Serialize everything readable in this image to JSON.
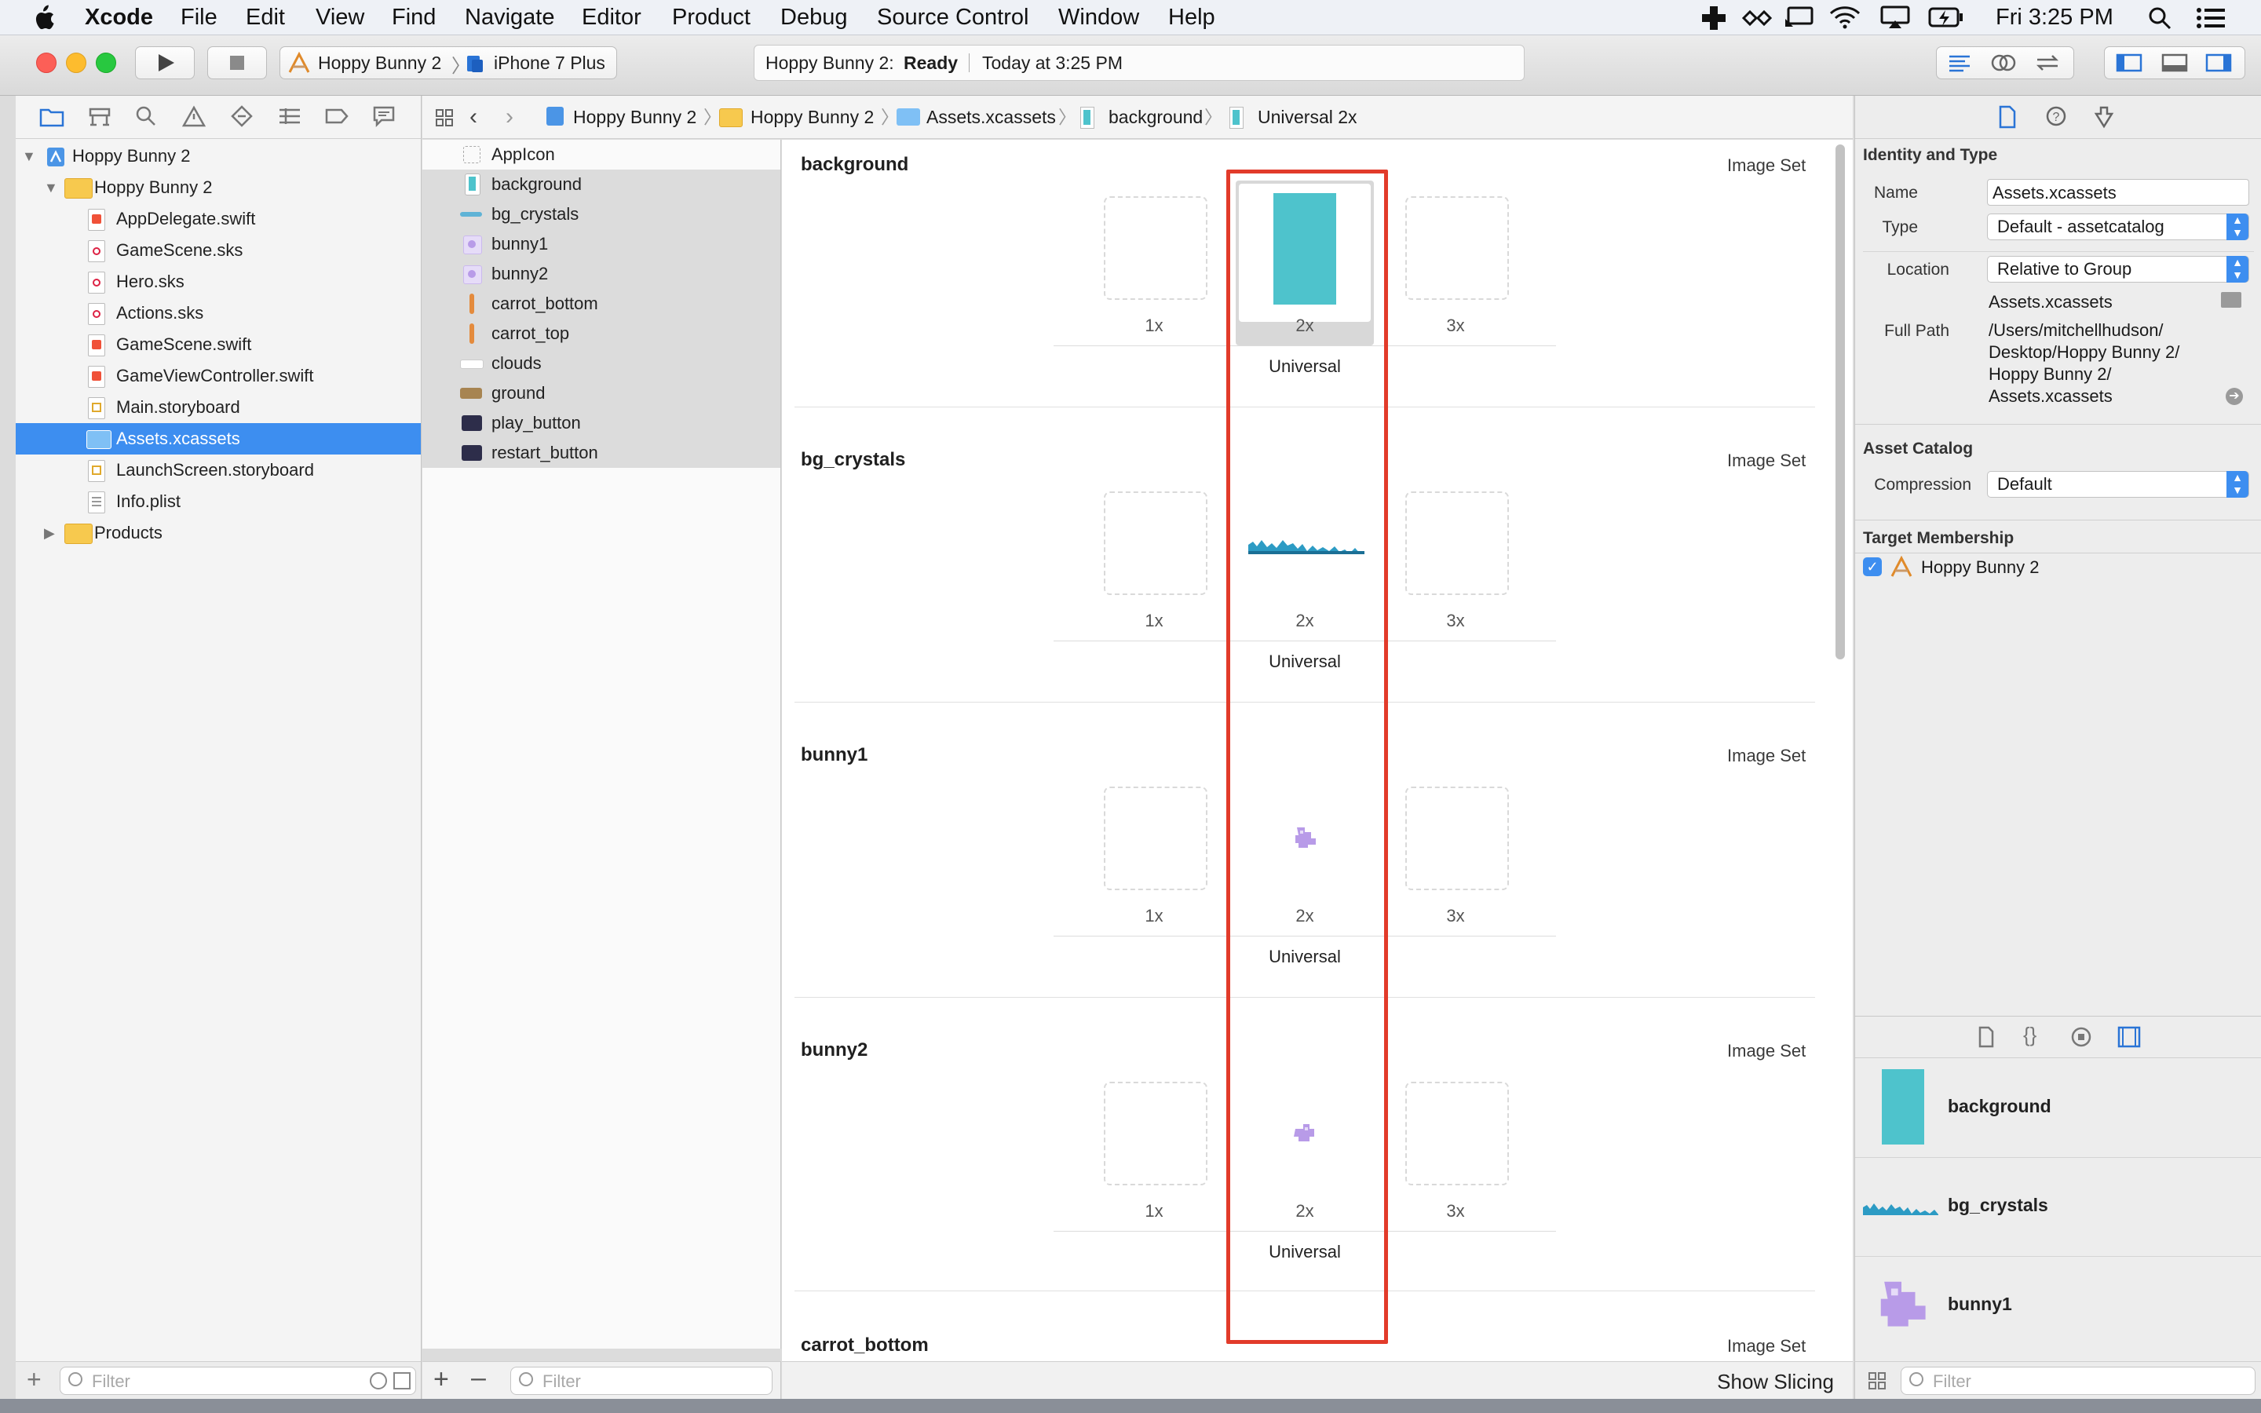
{
  "menubar": {
    "app_name": "Xcode",
    "menus": [
      "File",
      "Edit",
      "View",
      "Find",
      "Navigate",
      "Editor",
      "Product",
      "Debug",
      "Source Control",
      "Window",
      "Help"
    ],
    "clock": "Fri 3:25 PM"
  },
  "toolbar": {
    "scheme": "Hoppy Bunny 2",
    "device": "iPhone 7 Plus",
    "status_project": "Hoppy Bunny 2:",
    "status_state": "Ready",
    "status_time": "Today at 3:25 PM"
  },
  "navigator": {
    "project": "Hoppy Bunny 2",
    "group": "Hoppy Bunny 2",
    "files": [
      "AppDelegate.swift",
      "GameScene.sks",
      "Hero.sks",
      "Actions.sks",
      "GameScene.swift",
      "GameViewController.swift",
      "Main.storyboard",
      "Assets.xcassets",
      "LaunchScreen.storyboard",
      "Info.plist"
    ],
    "products": "Products",
    "filter_placeholder": "Filter"
  },
  "jumpbar": [
    "Hoppy Bunny 2",
    "Hoppy Bunny 2",
    "Assets.xcassets",
    "background",
    "Universal 2x"
  ],
  "assets": {
    "items": [
      "AppIcon",
      "background",
      "bg_crystals",
      "bunny1",
      "bunny2",
      "carrot_bottom",
      "carrot_top",
      "clouds",
      "ground",
      "play_button",
      "restart_button"
    ],
    "filter_placeholder": "Filter"
  },
  "editor": {
    "sets": [
      {
        "name": "background",
        "type": "Image Set",
        "slots": [
          "1x",
          "2x",
          "3x"
        ],
        "idiom": "Universal"
      },
      {
        "name": "bg_crystals",
        "type": "Image Set",
        "slots": [
          "1x",
          "2x",
          "3x"
        ],
        "idiom": "Universal"
      },
      {
        "name": "bunny1",
        "type": "Image Set",
        "slots": [
          "1x",
          "2x",
          "3x"
        ],
        "idiom": "Universal"
      },
      {
        "name": "bunny2",
        "type": "Image Set",
        "slots": [
          "1x",
          "2x",
          "3x"
        ],
        "idiom": "Universal"
      },
      {
        "name": "carrot_bottom",
        "type": "Image Set"
      }
    ],
    "show_slicing": "Show Slicing",
    "highlight_color": "#e23b2a"
  },
  "inspector": {
    "identity_header": "Identity and Type",
    "name_label": "Name",
    "name_value": "Assets.xcassets",
    "type_label": "Type",
    "type_value": "Default - assetcatalog",
    "location_label": "Location",
    "location_value": "Relative to Group",
    "location_file": "Assets.xcassets",
    "fullpath_label": "Full Path",
    "fullpath_lines": [
      "/Users/mitchellhudson/",
      "Desktop/Hoppy Bunny 2/",
      "Hoppy Bunny 2/",
      "Assets.xcassets"
    ],
    "catalog_header": "Asset Catalog",
    "compression_label": "Compression",
    "compression_value": "Default",
    "target_header": "Target Membership",
    "target_name": "Hoppy Bunny 2",
    "library": [
      "background",
      "bg_crystals",
      "bunny1"
    ],
    "filter_placeholder": "Filter"
  },
  "colors": {
    "accent": "#3d8ef0",
    "background_swatch": "#4ec3cc",
    "bunny_purple": "#b89be8"
  }
}
